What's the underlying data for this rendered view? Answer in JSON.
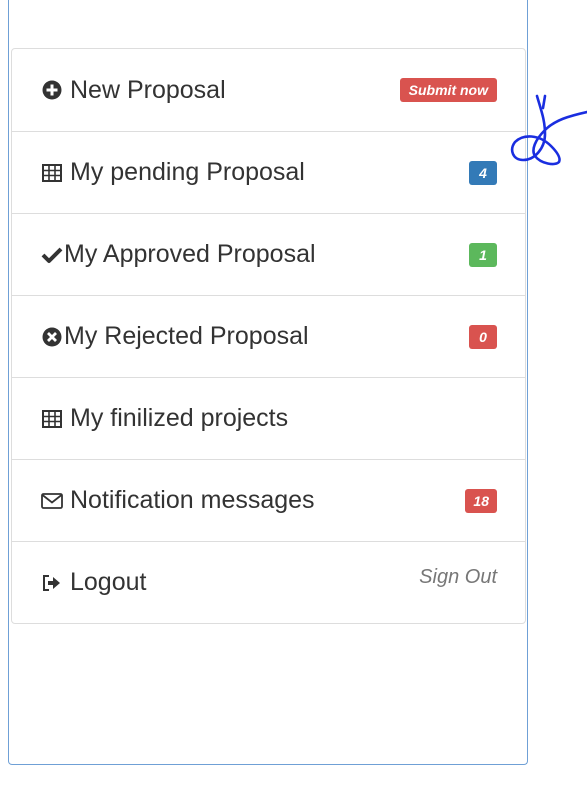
{
  "menu": {
    "items": [
      {
        "label": "New Proposal",
        "icon": "plus-circle-icon",
        "badge": "Submit now",
        "badge_color": "#d9534f"
      },
      {
        "label": "My pending Proposal",
        "icon": "table-icon",
        "badge": "4",
        "badge_color": "#337ab7"
      },
      {
        "label": "My Approved Proposal",
        "icon": "check-icon",
        "badge": "1",
        "badge_color": "#5cb85c"
      },
      {
        "label": "My Rejected Proposal",
        "icon": "x-circle-icon",
        "badge": "0",
        "badge_color": "#d9534f"
      },
      {
        "label": "My finilized projects",
        "icon": "table-icon"
      },
      {
        "label": "Notification messages",
        "icon": "envelope-icon",
        "badge": "18",
        "badge_color": "#d9534f"
      },
      {
        "label": "Logout",
        "icon": "logout-icon",
        "aside": "Sign Out"
      }
    ]
  },
  "colors": {
    "panel_border": "#6fa0d6",
    "annotation": "#1a2ee0"
  }
}
